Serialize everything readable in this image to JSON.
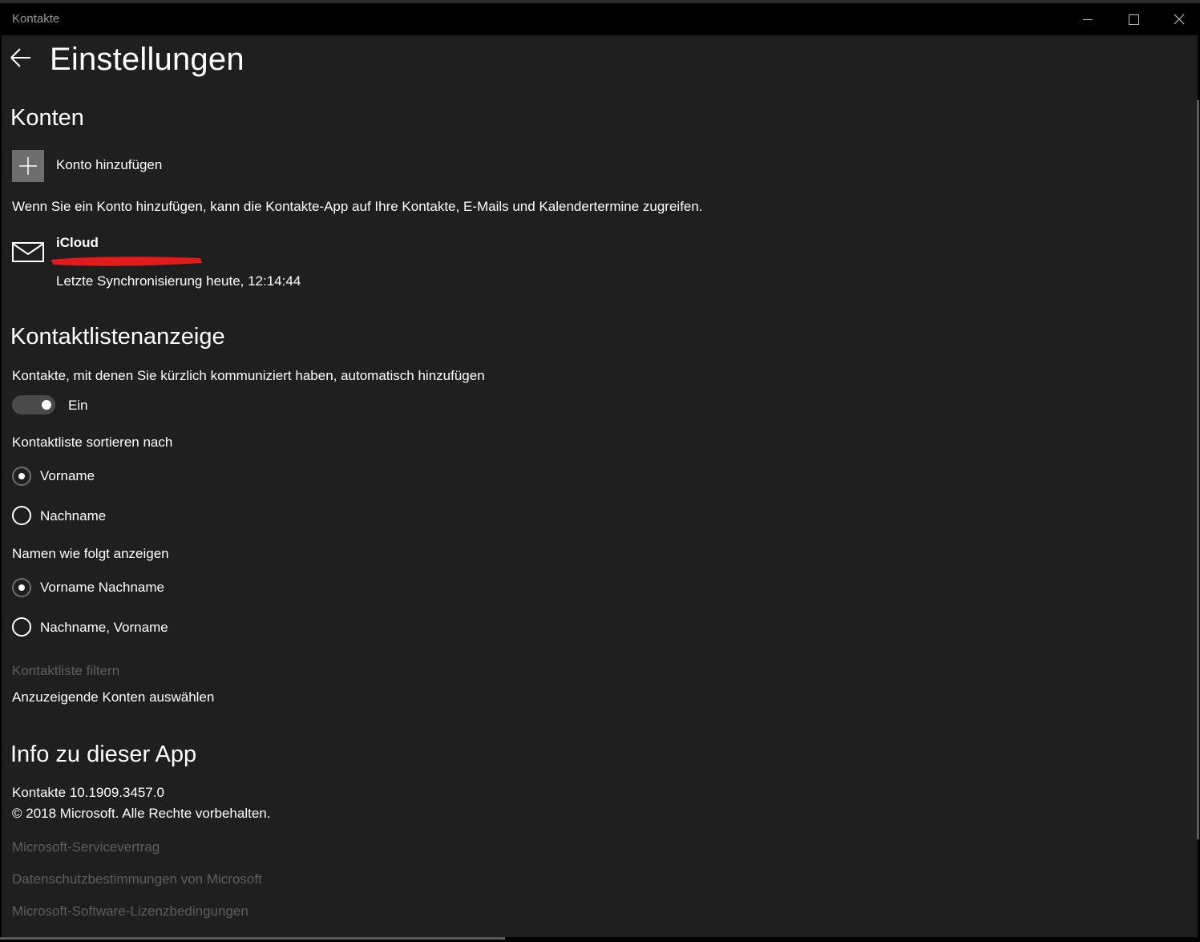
{
  "window": {
    "title": "Kontakte",
    "controls": [
      "minimize",
      "maximize",
      "close"
    ]
  },
  "header": {
    "back_icon": "arrow-left-icon",
    "title": "Einstellungen"
  },
  "accounts": {
    "section_title": "Konten",
    "add_icon": "plus-icon",
    "add_label": "Konto hinzufügen",
    "note": "Wenn Sie ein Konto hinzufügen, kann die Kontakte-App auf Ihre Kontakte, E-Mails und Kalendertermine zugreifen.",
    "items": [
      {
        "icon": "mail-icon",
        "name": "iCloud",
        "sync": "Letzte Synchronisierung heute, 12:14:44"
      }
    ]
  },
  "display": {
    "section_title": "Kontaktlistenanzeige",
    "auto_add_label": "Kontakte, mit denen Sie kürzlich kommuniziert haben, automatisch hinzufügen",
    "auto_add_state": "Ein",
    "sort_label": "Kontaktliste sortieren nach",
    "sort_options": [
      "Vorname",
      "Nachname"
    ],
    "sort_selected": "Vorname",
    "show_label": "Namen wie folgt anzeigen",
    "show_options": [
      "Vorname Nachname",
      "Nachname, Vorname"
    ],
    "show_selected": "Vorname Nachname",
    "filter_label": "Kontaktliste filtern",
    "select_accounts": "Anzuzeigende Konten auswählen"
  },
  "about": {
    "section_title": "Info zu dieser App",
    "version": "Kontakte 10.1909.3457.0",
    "copyright": "© 2018 Microsoft. Alle Rechte vorbehalten.",
    "links": [
      "Microsoft-Servicevertrag",
      "Datenschutzbestimmungen von Microsoft",
      "Microsoft-Software-Lizenzbedingungen"
    ]
  },
  "colors": {
    "background": "#1f1f1f",
    "titlebar": "#000000",
    "text": "#ffffff",
    "disabled_text": "#5e5e5e",
    "tile": "#6e6e6e",
    "redaction": "#e01b1b"
  }
}
